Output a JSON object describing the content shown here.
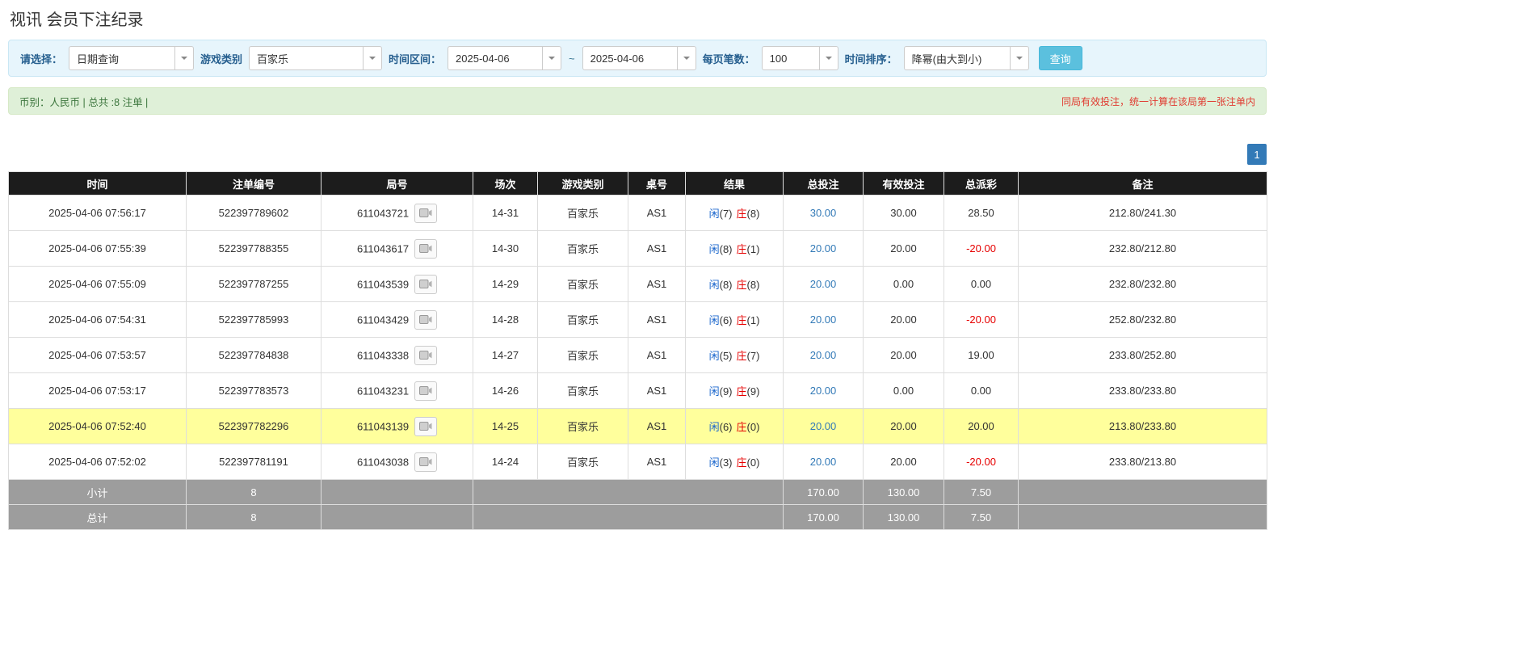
{
  "page_title": "视讯 会员下注纪录",
  "colors": {
    "link_blue": "#337ab7",
    "player_blue": "#1a66cc",
    "banker_red": "#e60000",
    "negative_red": "#e60000",
    "highlight_yellow": "#ffff9c",
    "table_header_bg": "#1c1c1c",
    "table_footer_bg": "#9d9d9d",
    "search_button_bg": "#5bc0de",
    "filter_bar_bg": "#e7f5fc",
    "info_bar_bg": "#dff0d8"
  },
  "filters": {
    "select_label": "请选择：",
    "select_value": "日期查询",
    "game_label": "游戏类别",
    "game_value": "百家乐",
    "range_label": "时间区间：",
    "date_from": "2025-04-06",
    "tilde": "~",
    "date_to": "2025-04-06",
    "per_page_label": "每页笔数：",
    "per_page_value": "100",
    "sort_label": "时间排序：",
    "sort_value": "降幂(由大到小)",
    "search_button": "查询"
  },
  "info_bar": {
    "left": "币别：人民币 | 总共 :8 注单 |",
    "right": "同局有效投注，统一计算在该局第一张注单内"
  },
  "pagination": {
    "current": "1"
  },
  "table": {
    "headers": [
      "时间",
      "注单编号",
      "局号",
      "场次",
      "游戏类别",
      "桌号",
      "结果",
      "总投注",
      "有效投注",
      "总派彩",
      "备注"
    ],
    "rows": [
      {
        "time": "2025-04-06 07:56:17",
        "bet_id": "522397789602",
        "round_id": "611043721",
        "session": "14-31",
        "game": "百家乐",
        "table_no": "AS1",
        "result": {
          "p_label": "闲",
          "p_val": "(7)",
          "b_label": "庄",
          "b_val": "(8)"
        },
        "total_bet": "30.00",
        "valid_bet": "30.00",
        "payout": "28.50",
        "payout_negative": false,
        "remark": "212.80/241.30",
        "highlight": false
      },
      {
        "time": "2025-04-06 07:55:39",
        "bet_id": "522397788355",
        "round_id": "611043617",
        "session": "14-30",
        "game": "百家乐",
        "table_no": "AS1",
        "result": {
          "p_label": "闲",
          "p_val": "(8)",
          "b_label": "庄",
          "b_val": "(1)"
        },
        "total_bet": "20.00",
        "valid_bet": "20.00",
        "payout": "-20.00",
        "payout_negative": true,
        "remark": "232.80/212.80",
        "highlight": false
      },
      {
        "time": "2025-04-06 07:55:09",
        "bet_id": "522397787255",
        "round_id": "611043539",
        "session": "14-29",
        "game": "百家乐",
        "table_no": "AS1",
        "result": {
          "p_label": "闲",
          "p_val": "(8)",
          "b_label": "庄",
          "b_val": "(8)"
        },
        "total_bet": "20.00",
        "valid_bet": "0.00",
        "payout": "0.00",
        "payout_negative": false,
        "remark": "232.80/232.80",
        "highlight": false
      },
      {
        "time": "2025-04-06 07:54:31",
        "bet_id": "522397785993",
        "round_id": "611043429",
        "session": "14-28",
        "game": "百家乐",
        "table_no": "AS1",
        "result": {
          "p_label": "闲",
          "p_val": "(6)",
          "b_label": "庄",
          "b_val": "(1)"
        },
        "total_bet": "20.00",
        "valid_bet": "20.00",
        "payout": "-20.00",
        "payout_negative": true,
        "remark": "252.80/232.80",
        "highlight": false
      },
      {
        "time": "2025-04-06 07:53:57",
        "bet_id": "522397784838",
        "round_id": "611043338",
        "session": "14-27",
        "game": "百家乐",
        "table_no": "AS1",
        "result": {
          "p_label": "闲",
          "p_val": "(5)",
          "b_label": "庄",
          "b_val": "(7)"
        },
        "total_bet": "20.00",
        "valid_bet": "20.00",
        "payout": "19.00",
        "payout_negative": false,
        "remark": "233.80/252.80",
        "highlight": false
      },
      {
        "time": "2025-04-06 07:53:17",
        "bet_id": "522397783573",
        "round_id": "611043231",
        "session": "14-26",
        "game": "百家乐",
        "table_no": "AS1",
        "result": {
          "p_label": "闲",
          "p_val": "(9)",
          "b_label": "庄",
          "b_val": "(9)"
        },
        "total_bet": "20.00",
        "valid_bet": "0.00",
        "payout": "0.00",
        "payout_negative": false,
        "remark": "233.80/233.80",
        "highlight": false
      },
      {
        "time": "2025-04-06 07:52:40",
        "bet_id": "522397782296",
        "round_id": "611043139",
        "session": "14-25",
        "game": "百家乐",
        "table_no": "AS1",
        "result": {
          "p_label": "闲",
          "p_val": "(6)",
          "b_label": "庄",
          "b_val": "(0)"
        },
        "total_bet": "20.00",
        "valid_bet": "20.00",
        "payout": "20.00",
        "payout_negative": false,
        "remark": "213.80/233.80",
        "highlight": true
      },
      {
        "time": "2025-04-06 07:52:02",
        "bet_id": "522397781191",
        "round_id": "611043038",
        "session": "14-24",
        "game": "百家乐",
        "table_no": "AS1",
        "result": {
          "p_label": "闲",
          "p_val": "(3)",
          "b_label": "庄",
          "b_val": "(0)"
        },
        "total_bet": "20.00",
        "valid_bet": "20.00",
        "payout": "-20.00",
        "payout_negative": true,
        "remark": "233.80/213.80",
        "highlight": false
      }
    ],
    "subtotal": {
      "label": "小计",
      "count": "8",
      "total_bet": "170.00",
      "valid_bet": "130.00",
      "payout": "7.50"
    },
    "total": {
      "label": "总计",
      "count": "8",
      "total_bet": "170.00",
      "valid_bet": "130.00",
      "payout": "7.50"
    }
  }
}
